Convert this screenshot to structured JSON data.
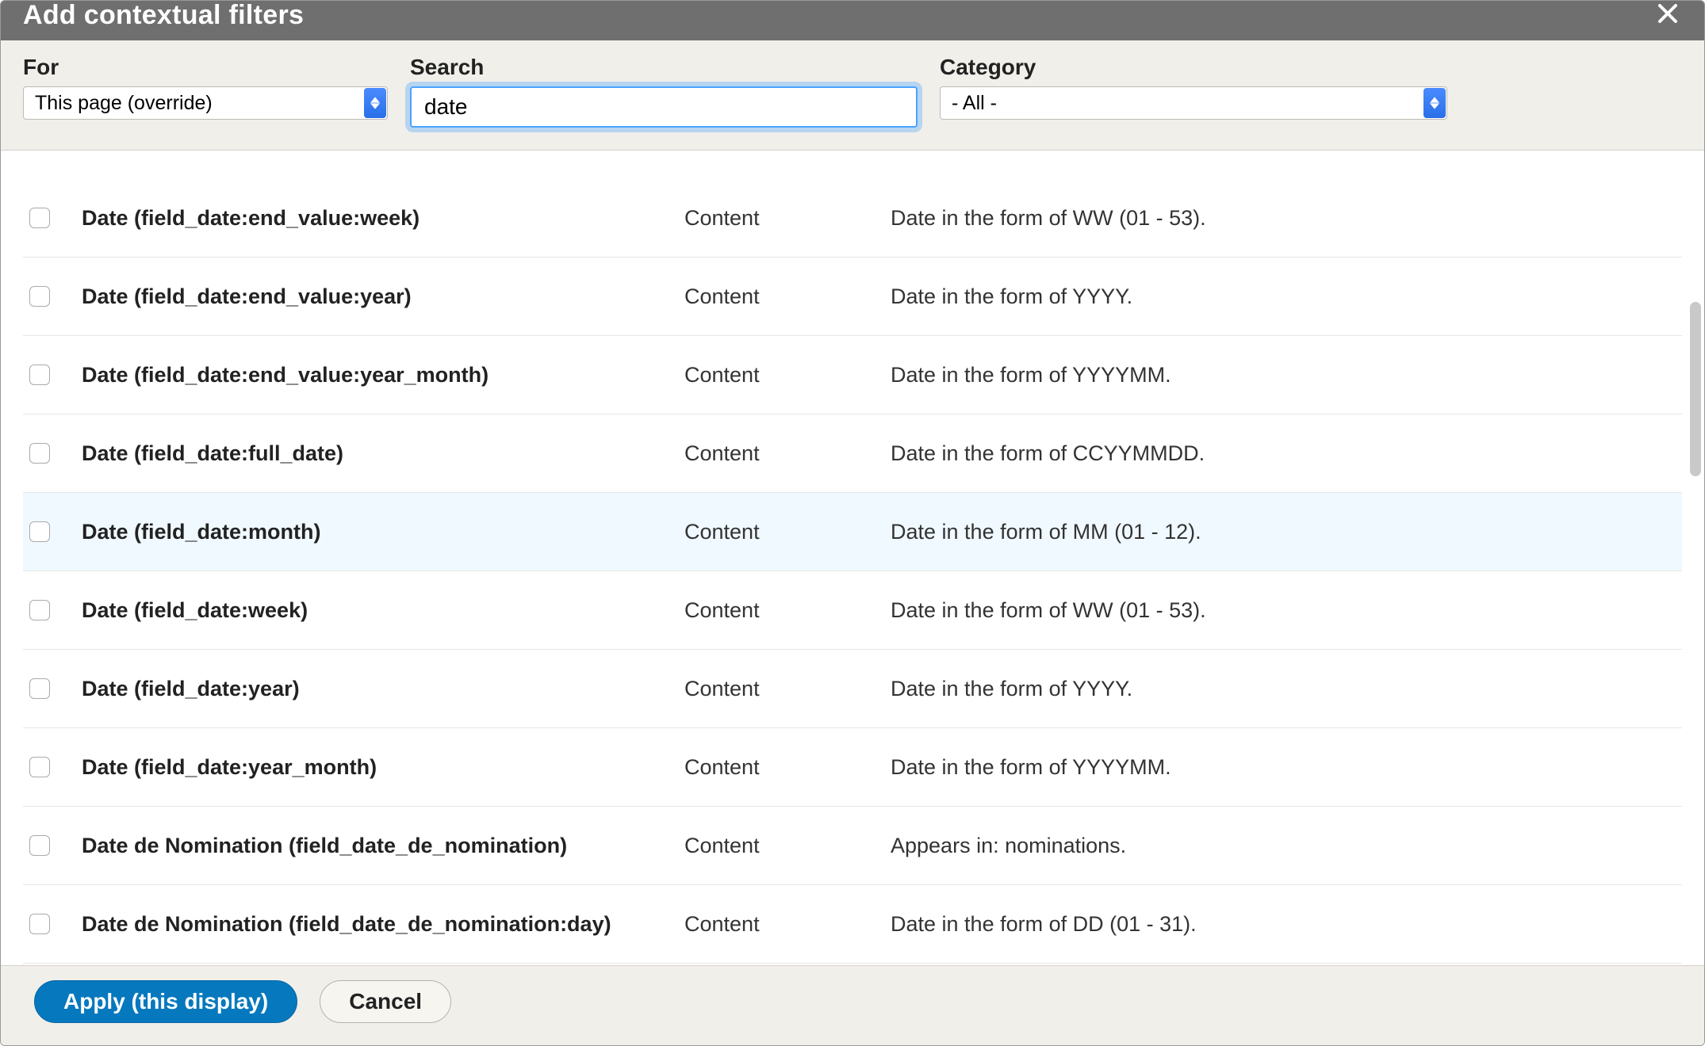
{
  "header": {
    "title": "Add contextual filters"
  },
  "filters": {
    "for_label": "For",
    "for_value": "This page (override)",
    "search_label": "Search",
    "search_value": "date",
    "category_label": "Category",
    "category_value": "- All -"
  },
  "rows": [
    {
      "name": "Date (field_date:end_value:week)",
      "category": "Content",
      "desc": "Date in the form of WW (01 - 53)."
    },
    {
      "name": "Date (field_date:end_value:year)",
      "category": "Content",
      "desc": "Date in the form of YYYY."
    },
    {
      "name": "Date (field_date:end_value:year_month)",
      "category": "Content",
      "desc": "Date in the form of YYYYMM."
    },
    {
      "name": "Date (field_date:full_date)",
      "category": "Content",
      "desc": "Date in the form of CCYYMMDD."
    },
    {
      "name": "Date (field_date:month)",
      "category": "Content",
      "desc": "Date in the form of MM (01 - 12).",
      "hovered": true
    },
    {
      "name": "Date (field_date:week)",
      "category": "Content",
      "desc": "Date in the form of WW (01 - 53)."
    },
    {
      "name": "Date (field_date:year)",
      "category": "Content",
      "desc": "Date in the form of YYYY."
    },
    {
      "name": "Date (field_date:year_month)",
      "category": "Content",
      "desc": "Date in the form of YYYYMM."
    },
    {
      "name": "Date de Nomination (field_date_de_nomination)",
      "category": "Content",
      "desc": "Appears in: nominations."
    },
    {
      "name": "Date de Nomination (field_date_de_nomination:day)",
      "category": "Content",
      "desc": "Date in the form of DD (01 - 31)."
    }
  ],
  "footer": {
    "apply_label": "Apply (this display)",
    "cancel_label": "Cancel"
  }
}
